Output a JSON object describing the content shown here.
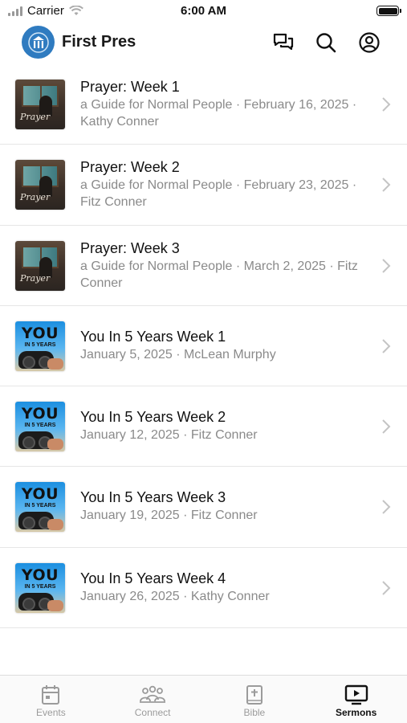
{
  "status_bar": {
    "carrier": "Carrier",
    "time": "6:00 AM"
  },
  "header": {
    "title": "First Pres"
  },
  "sermons": [
    {
      "title": "Prayer: Week 1",
      "subtitle": "a Guide for Normal People · February 16, 2025 · Kathy Conner",
      "thumb": "prayer",
      "thumb_text": "Prayer"
    },
    {
      "title": "Prayer: Week 2",
      "subtitle": "a Guide for Normal People · February 23, 2025 · Fitz Conner",
      "thumb": "prayer",
      "thumb_text": "Prayer"
    },
    {
      "title": "Prayer: Week 3",
      "subtitle": "a Guide for Normal People · March 2, 2025 · Fitz Conner",
      "thumb": "prayer",
      "thumb_text": "Prayer"
    },
    {
      "title": "You In 5 Years Week 1",
      "subtitle": "January 5, 2025 · McLean Murphy",
      "thumb": "you",
      "thumb_big": "YOU",
      "thumb_small": "IN 5 YEARS"
    },
    {
      "title": "You In 5 Years Week 2",
      "subtitle": "January 12, 2025 · Fitz Conner",
      "thumb": "you",
      "thumb_big": "YOU",
      "thumb_small": "IN 5 YEARS"
    },
    {
      "title": "You In 5 Years Week 3",
      "subtitle": "January 19, 2025 · Fitz Conner",
      "thumb": "you",
      "thumb_big": "YOU",
      "thumb_small": "IN 5 YEARS"
    },
    {
      "title": "You In 5 Years Week 4",
      "subtitle": "January 26, 2025 · Kathy Conner",
      "thumb": "you",
      "thumb_big": "YOU",
      "thumb_small": "IN 5 YEARS"
    }
  ],
  "tabs": [
    {
      "label": "Events",
      "icon": "calendar-icon",
      "active": false
    },
    {
      "label": "Connect",
      "icon": "people-icon",
      "active": false
    },
    {
      "label": "Bible",
      "icon": "bible-icon",
      "active": false
    },
    {
      "label": "Sermons",
      "icon": "play-screen-icon",
      "active": true
    }
  ],
  "colors": {
    "accent": "#2f7bc0",
    "inactive": "#9b9b9b",
    "active": "#111111"
  }
}
